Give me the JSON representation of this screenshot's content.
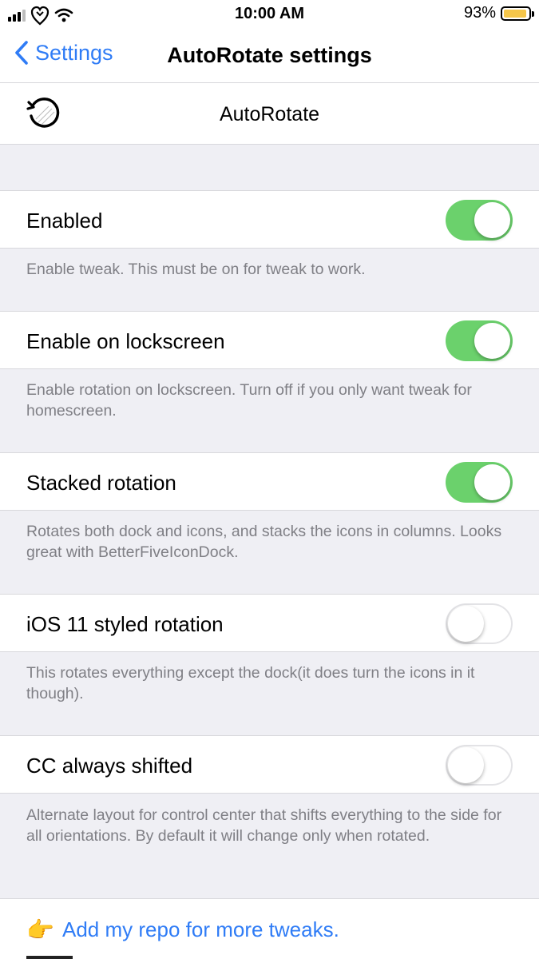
{
  "status_bar": {
    "time": "10:00 AM",
    "battery_percent": "93%",
    "battery_level": 0.93,
    "icons": [
      "cellular-signal-icon",
      "heart-logo-icon",
      "wifi-icon",
      "battery-icon"
    ]
  },
  "nav": {
    "back_label": "Settings",
    "title": "AutoRotate settings"
  },
  "header": {
    "label": "AutoRotate",
    "icon": "rotate-icon"
  },
  "settings": [
    {
      "label": "Enabled",
      "on": true,
      "footer": "Enable tweak. This must be on for tweak to work."
    },
    {
      "label": "Enable on lockscreen",
      "on": true,
      "footer": "Enable rotation on lockscreen. Turn off if you only want tweak for homescreen."
    },
    {
      "label": "Stacked rotation",
      "on": true,
      "footer": "Rotates both dock and icons, and stacks the icons in columns. Looks great with BetterFiveIconDock."
    },
    {
      "label": "iOS 11 styled rotation",
      "on": false,
      "footer": "This rotates everything except the dock(it does turn the icons in it though)."
    },
    {
      "label": "CC always shifted",
      "on": false,
      "footer": "Alternate layout for control center that shifts everything to the side for all orientations. By default it will change only when rotated."
    }
  ],
  "link": {
    "emoji": "👉",
    "label": "Add my repo for more tweaks."
  },
  "colors": {
    "accent": "#2f7cf6",
    "switch_on": "#6bd16c",
    "background": "#efeff4"
  }
}
